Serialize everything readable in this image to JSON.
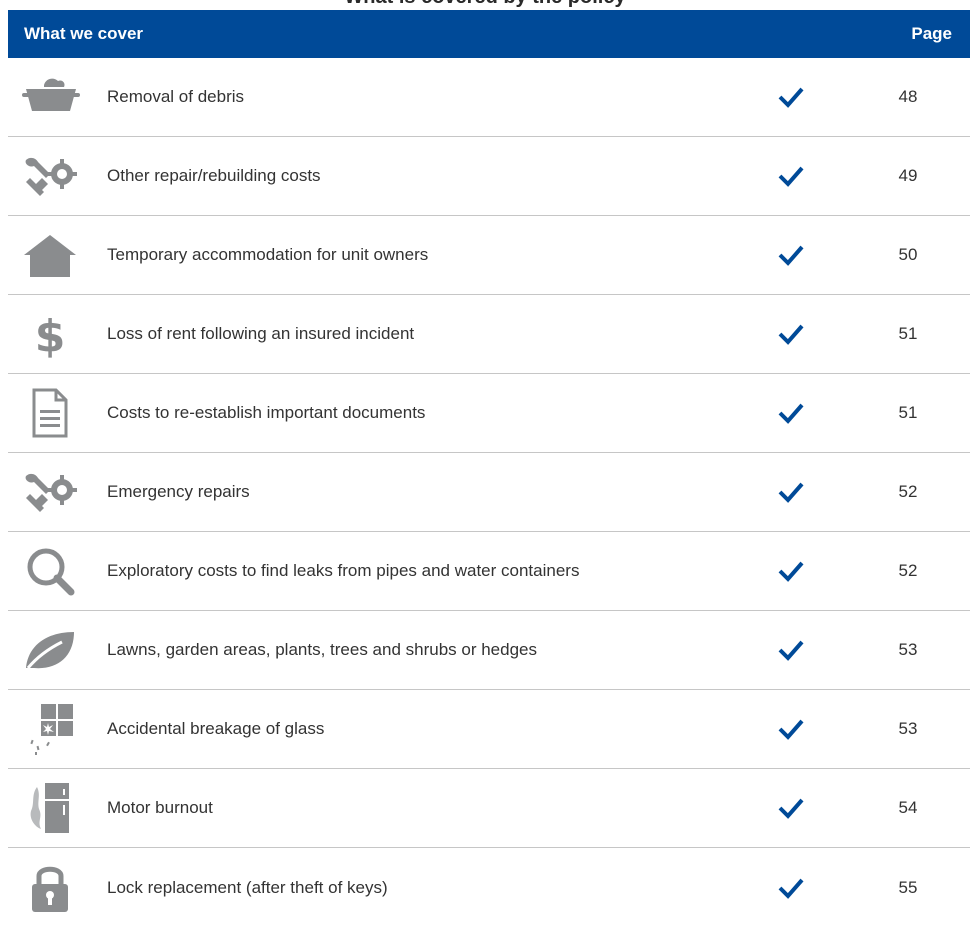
{
  "page_title_clipped": "What is covered by the policy",
  "header": {
    "left": "What we cover",
    "right": "Page"
  },
  "colors": {
    "header": "#004a98",
    "check": "#004a98",
    "icon": "#8a8c8e",
    "divider": "#c6c6c6"
  },
  "rows": [
    {
      "icon": "debris-icon",
      "label": "Removal of debris",
      "covered": true,
      "page": "48"
    },
    {
      "icon": "repair-tools-icon",
      "label": "Other repair/rebuilding costs",
      "covered": true,
      "page": "49"
    },
    {
      "icon": "house-icon",
      "label": "Temporary accommodation for unit owners",
      "covered": true,
      "page": "50"
    },
    {
      "icon": "dollar-icon",
      "label": "Loss of rent following an insured incident",
      "covered": true,
      "page": "51"
    },
    {
      "icon": "document-icon",
      "label": "Costs to re-establish important documents",
      "covered": true,
      "page": "51"
    },
    {
      "icon": "repair-tools-icon",
      "label": "Emergency repairs",
      "covered": true,
      "page": "52"
    },
    {
      "icon": "magnifier-icon",
      "label": "Exploratory costs to find leaks from pipes and water containers",
      "covered": true,
      "page": "52"
    },
    {
      "icon": "leaf-icon",
      "label": "Lawns, garden areas, plants, trees and shrubs or hedges",
      "covered": true,
      "page": "53"
    },
    {
      "icon": "broken-glass-icon",
      "label": "Accidental breakage of glass",
      "covered": true,
      "page": "53"
    },
    {
      "icon": "fridge-burnout-icon",
      "label": "Motor burnout",
      "covered": true,
      "page": "54"
    },
    {
      "icon": "padlock-icon",
      "label": "Lock replacement (after theft of keys)",
      "covered": true,
      "page": "55"
    }
  ]
}
